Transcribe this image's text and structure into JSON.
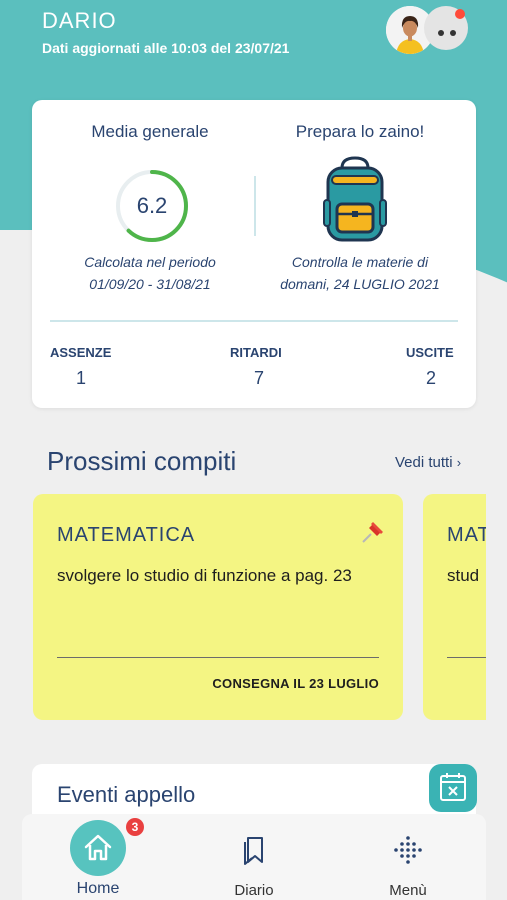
{
  "header": {
    "student_name": "DARIO",
    "update_info": "Dati aggiornati alle 10:03 del 23/07/21",
    "colors": {
      "teal": "#5bbfbe",
      "notification_dot": "#ff4b3a"
    }
  },
  "summary": {
    "average": {
      "title": "Media generale",
      "value": "6.2",
      "progress_fraction": 0.62,
      "period_label": "Calcolata nel periodo",
      "period_range": "01/09/20 - 31/08/21"
    },
    "backpack": {
      "title": "Prepara lo zaino!",
      "note_line1": "Controlla le materie di",
      "note_line2": "domani, 24 LUGLIO 2021",
      "icon": "backpack-icon"
    },
    "stats": [
      {
        "label": "ASSENZE",
        "value": "1"
      },
      {
        "label": "RITARDI",
        "value": "7"
      },
      {
        "label": "USCITE",
        "value": "2"
      }
    ]
  },
  "homework": {
    "section_title": "Prossimi compiti",
    "see_all": "Vedi tutti",
    "cards": [
      {
        "subject": "MATEMATICA",
        "text": "svolgere lo studio di funzione a pag. 23",
        "due": "CONSEGNA IL 23 LUGLIO",
        "pinned": true
      },
      {
        "subject": "MAT",
        "text": "stud",
        "due": ""
      }
    ]
  },
  "events": {
    "title": "Eventi appello"
  },
  "nav": {
    "home_label": "Home",
    "home_badge": "3",
    "diary_label": "Diario",
    "menu_label": "Menù"
  }
}
